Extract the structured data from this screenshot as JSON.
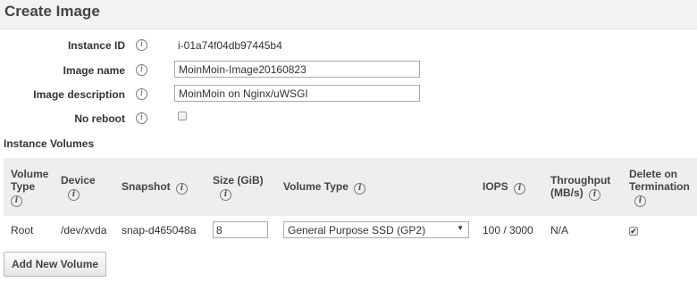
{
  "header": {
    "title": "Create Image"
  },
  "fields": {
    "instance_id": {
      "label": "Instance ID",
      "value": "i-01a74f04db97445b4"
    },
    "image_name": {
      "label": "Image name",
      "value": "MoinMoin-Image20160823"
    },
    "image_description": {
      "label": "Image description",
      "value": "MoinMoin on Nginx/uWSGI"
    },
    "no_reboot": {
      "label": "No reboot",
      "checked": false
    }
  },
  "info_glyph": "i",
  "volumes": {
    "title": "Instance Volumes",
    "columns": {
      "volume_type": [
        "Volume",
        "Type"
      ],
      "device": "Device",
      "snapshot": "Snapshot",
      "size": "Size (GiB)",
      "vol_type": "Volume Type",
      "iops": "IOPS",
      "throughput": [
        "Throughput",
        "(MB/s)"
      ],
      "delete": [
        "Delete on",
        "Termination"
      ]
    },
    "rows": [
      {
        "volume_type": "Root",
        "device": "/dev/xvda",
        "snapshot": "snap-d465048a",
        "size": "8",
        "vol_type": "General Purpose SSD (GP2)",
        "iops": "100 / 3000",
        "throughput": "N/A",
        "delete_on_termination": true
      }
    ]
  },
  "add_button": "Add New Volume",
  "check_glyph": "✔",
  "caret_glyph": "▼"
}
